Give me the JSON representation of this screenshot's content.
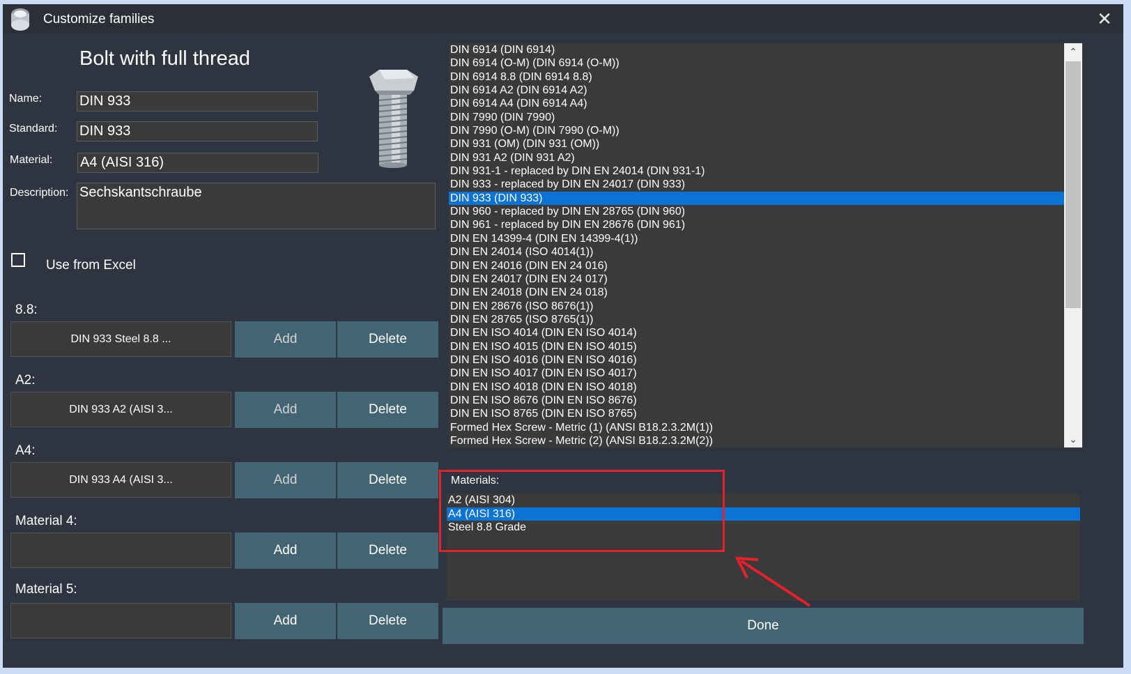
{
  "window": {
    "title": "Customize families",
    "close_glyph": "✕"
  },
  "family": {
    "heading": "Bolt with full thread"
  },
  "form": {
    "name_label": "Name:",
    "name_value": "DIN 933",
    "standard_label": "Standard:",
    "standard_value": "DIN 933",
    "material_label": "Material:",
    "material_value": "A4 (AISI 316)",
    "description_label": "Description:",
    "description_value": "Sechskantschraube"
  },
  "excel": {
    "label": "Use from Excel",
    "checked": false
  },
  "slots": [
    {
      "label": "8.8:",
      "value": "DIN 933 Steel 8.8 ...",
      "add": "Add",
      "delete": "Delete"
    },
    {
      "label": "A2:",
      "value": "DIN 933 A2 (AISI 3...",
      "add": "Add",
      "delete": "Delete"
    },
    {
      "label": "A4:",
      "value": "DIN 933 A4 (AISI 3...",
      "add": "Add",
      "delete": "Delete"
    },
    {
      "label": "Material 4:",
      "value": "",
      "add": "Add",
      "delete": "Delete"
    },
    {
      "label": "Material 5:",
      "value": "",
      "add": "Add",
      "delete": "Delete"
    }
  ],
  "families": [
    "DIN 6914 (DIN 6914)",
    "DIN 6914 (O-M) (DIN 6914 (O-M))",
    "DIN 6914 8.8 (DIN 6914 8.8)",
    "DIN 6914 A2 (DIN 6914 A2)",
    "DIN 6914 A4 (DIN 6914 A4)",
    "DIN 7990 (DIN 7990)",
    "DIN 7990 (O-M) (DIN 7990 (O-M))",
    "DIN 931 (OM) (DIN 931 (OM))",
    "DIN 931 A2 (DIN 931 A2)",
    "DIN 931-1 - replaced by DIN EN 24014 (DIN 931-1)",
    "DIN 933 - replaced by DIN EN 24017 (DIN 933)",
    "DIN 933 (DIN 933)",
    "DIN 960 - replaced by DIN EN 28765 (DIN 960)",
    "DIN 961 - replaced by DIN EN 28676 (DIN 961)",
    "DIN EN 14399-4 (DIN EN 14399-4(1))",
    "DIN EN 24014 (ISO 4014(1))",
    "DIN EN 24016 (DIN EN 24 016)",
    "DIN EN 24017 (DIN EN 24 017)",
    "DIN EN 24018 (DIN EN 24 018)",
    "DIN EN 28676 (ISO 8676(1))",
    "DIN EN 28765 (ISO 8765(1))",
    "DIN EN ISO 4014 (DIN EN ISO 4014)",
    "DIN EN ISO 4015 (DIN EN ISO 4015)",
    "DIN EN ISO 4016 (DIN EN ISO 4016)",
    "DIN EN ISO 4017 (DIN EN ISO 4017)",
    "DIN EN ISO 4018 (DIN EN ISO 4018)",
    "DIN EN ISO 8676 (DIN EN ISO 8676)",
    "DIN EN ISO 8765 (DIN EN ISO 8765)",
    "Formed Hex Screw - Metric (1) (ANSI B18.2.3.2M(1))",
    "Formed Hex Screw - Metric (2) (ANSI B18.2.3.2M(2))"
  ],
  "families_selected_index": 11,
  "scroll": {
    "up_glyph": "⌃",
    "down_glyph": "⌄"
  },
  "materials": {
    "label": "Materials:",
    "items": [
      "A2 (AISI 304)",
      "A4 (AISI 316)",
      "Steel 8.8 Grade"
    ],
    "selected_index": 1
  },
  "done_label": "Done",
  "colors": {
    "accent": "#0a73d4",
    "button": "#436573",
    "annotation": "#e8202a"
  }
}
